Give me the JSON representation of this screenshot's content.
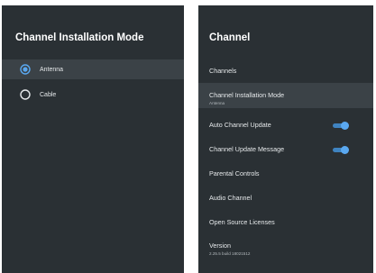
{
  "left_panel": {
    "title": "Channel Installation Mode",
    "options": [
      {
        "label": "Antenna",
        "selected": true
      },
      {
        "label": "Cable",
        "selected": false
      }
    ]
  },
  "right_panel": {
    "title": "Channel",
    "items": [
      {
        "label": "Channels"
      },
      {
        "label": "Channel Installation Mode",
        "sub": "Antenna"
      },
      {
        "label": "Auto Channel Update",
        "toggle": "on"
      },
      {
        "label": "Channel Update Message",
        "toggle": "on"
      },
      {
        "label": "Parental Controls"
      },
      {
        "label": "Audio Channel"
      },
      {
        "label": "Open Source Licenses"
      },
      {
        "label": "Version",
        "sub": "2.25.5 build 18021512"
      }
    ]
  },
  "colors": {
    "panel_bg": "#2a3034",
    "highlight_bg": "#3b4247",
    "accent": "#5aa8f0"
  }
}
